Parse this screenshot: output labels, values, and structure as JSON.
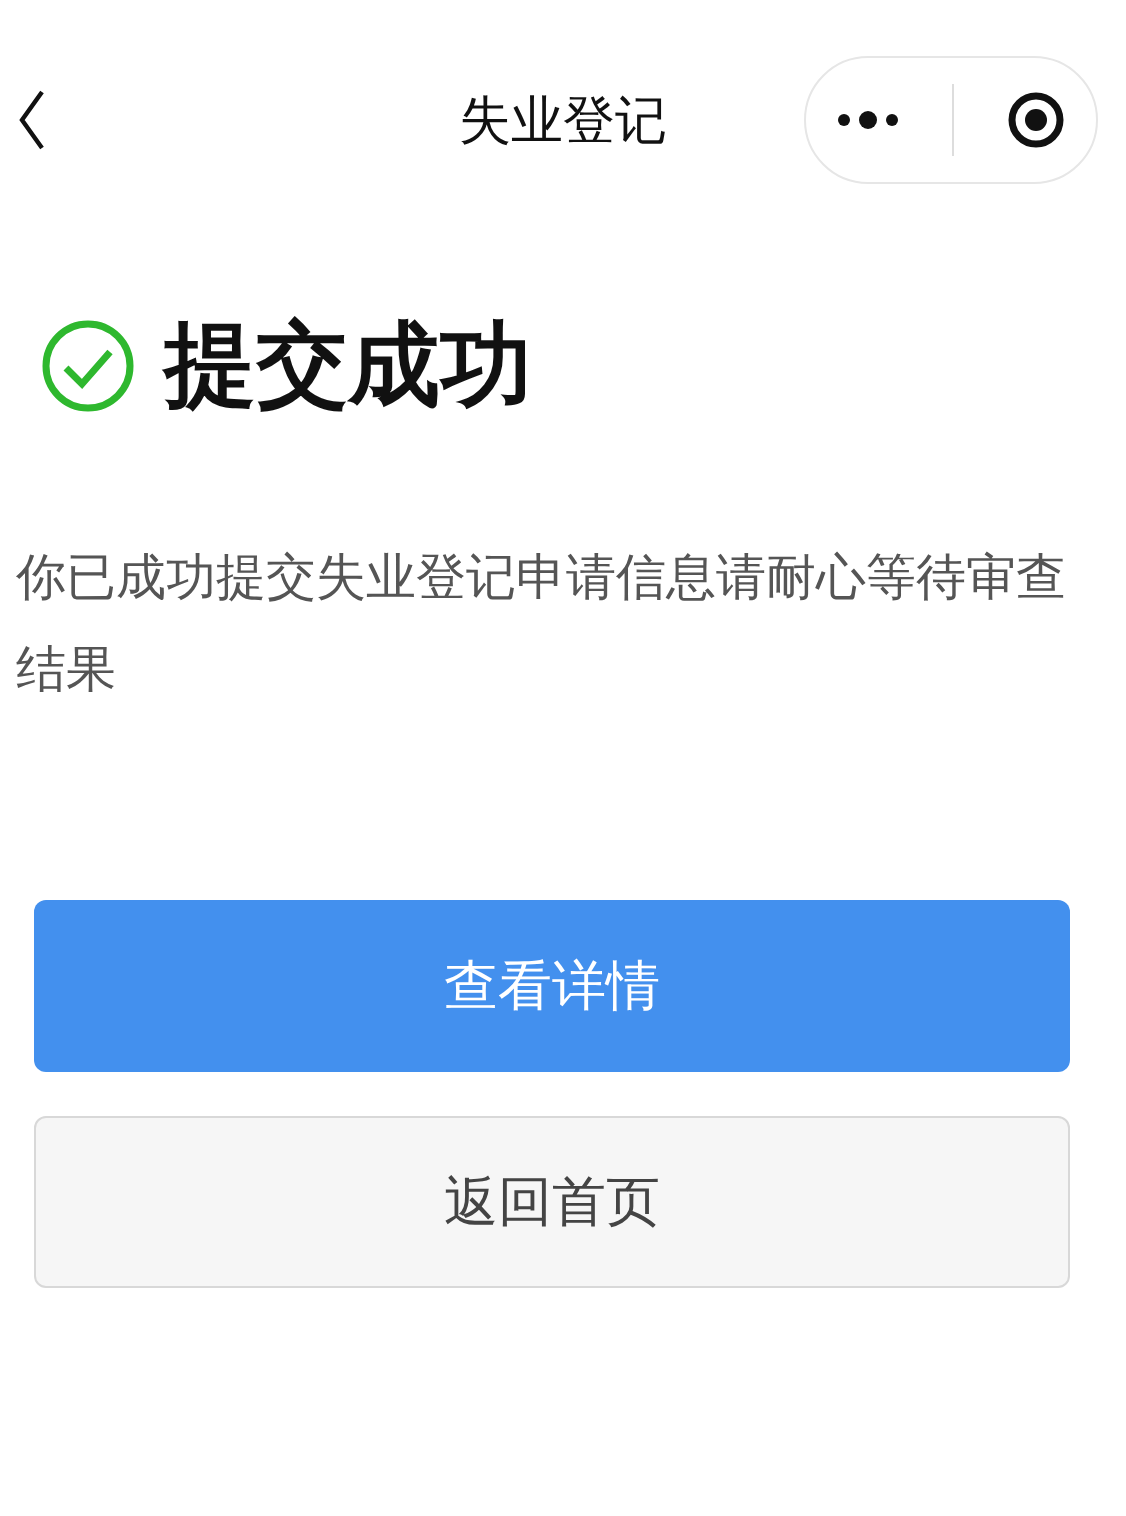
{
  "nav": {
    "title": "失业登记"
  },
  "result": {
    "title": "提交成功",
    "message": "你已成功提交失业登记申请信息请耐心等待审查结果"
  },
  "buttons": [
    {
      "label": "查看详情",
      "kind": "primary"
    },
    {
      "label": "返回首页",
      "kind": "default"
    }
  ]
}
